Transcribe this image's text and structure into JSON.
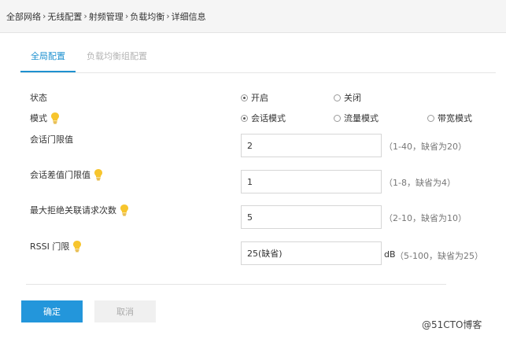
{
  "breadcrumb": [
    "全部网络",
    "无线配置",
    "射频管理",
    "负载均衡",
    "详细信息"
  ],
  "breadcrumb_sep": "›",
  "tabs": {
    "global": "全局配置",
    "group": "负载均衡组配置"
  },
  "form": {
    "status": {
      "label": "状态",
      "options": [
        "开启",
        "关闭"
      ],
      "selected": "开启"
    },
    "mode": {
      "label": "模式",
      "options": [
        "会话模式",
        "流量模式",
        "带宽模式"
      ],
      "selected": "会话模式"
    },
    "session_threshold": {
      "label": "会话门限值",
      "value": "2",
      "hint": "（1-40，缺省为20）"
    },
    "session_diff_threshold": {
      "label": "会话差值门限值",
      "value": "1",
      "hint": "（1-8，缺省为4）"
    },
    "max_reject": {
      "label": "最大拒绝关联请求次数",
      "value": "5",
      "hint": "（2-10，缺省为10）"
    },
    "rssi": {
      "label": "RSSI 门限",
      "value": "25(缺省)",
      "unit": "dB",
      "hint": "（5-100，缺省为25）"
    }
  },
  "buttons": {
    "ok": "确定",
    "cancel": "取消"
  },
  "watermark": "@51CTO博客",
  "colors": {
    "accent": "#2396db",
    "tab_active": "#1e91d0",
    "bulb": "#f7c52d"
  }
}
